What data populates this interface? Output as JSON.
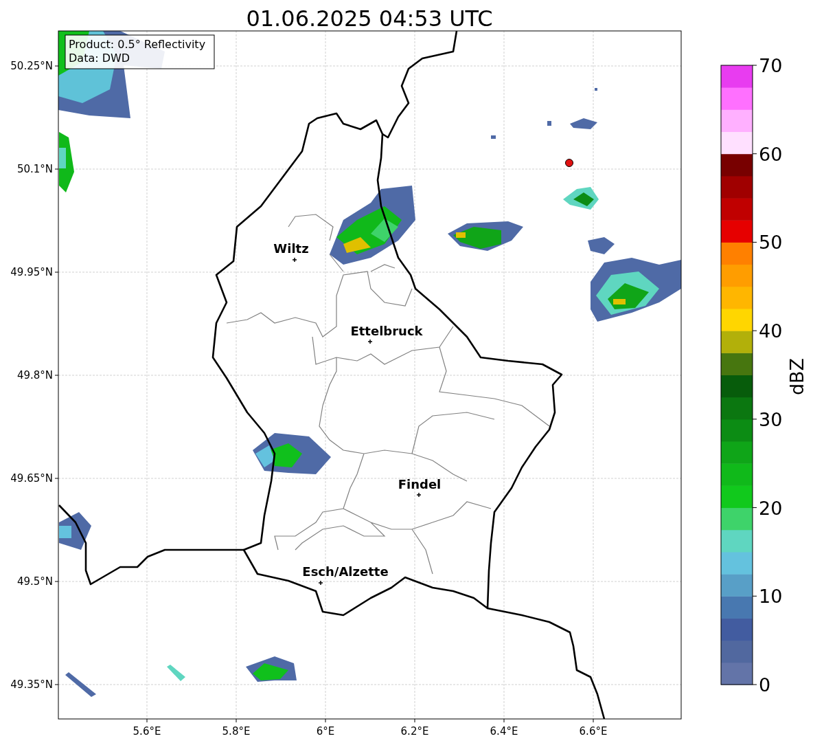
{
  "title": "01.06.2025 04:53 UTC",
  "info_box": [
    "Product: 0.5° Reflectivity",
    "Data: DWD"
  ],
  "map": {
    "x_ticks": [
      "5.6°E",
      "5.8°E",
      "6°E",
      "6.2°E",
      "6.4°E",
      "6.6°E"
    ],
    "y_ticks": [
      "50.25°N",
      "50.1°N",
      "49.95°N",
      "49.8°N",
      "49.65°N",
      "49.5°N",
      "49.35°N"
    ],
    "cities": [
      {
        "name": "Wiltz"
      },
      {
        "name": "Ettelbruck"
      },
      {
        "name": "Findel"
      },
      {
        "name": "Esch/Alzette"
      }
    ]
  },
  "colorbar": {
    "label": "dBZ",
    "ticks": [
      "70",
      "60",
      "50",
      "40",
      "30",
      "20",
      "10",
      "0"
    ],
    "bins": [
      {
        "color": "#6374a8"
      },
      {
        "color": "#51689f"
      },
      {
        "color": "#425ca0"
      },
      {
        "color": "#4878b0"
      },
      {
        "color": "#589fc7"
      },
      {
        "color": "#64c2de"
      },
      {
        "color": "#5fd6c0"
      },
      {
        "color": "#3ed36a"
      },
      {
        "color": "#11c91c"
      },
      {
        "color": "#10b91a"
      },
      {
        "color": "#0fa518"
      },
      {
        "color": "#0c8c14"
      },
      {
        "color": "#0b7710"
      },
      {
        "color": "#075c0b"
      },
      {
        "color": "#47760f"
      },
      {
        "color": "#b2b00a"
      },
      {
        "color": "#ffd600"
      },
      {
        "color": "#ffb600"
      },
      {
        "color": "#ff9d00"
      },
      {
        "color": "#ff8000"
      },
      {
        "color": "#e60000"
      },
      {
        "color": "#c00000"
      },
      {
        "color": "#a00000"
      },
      {
        "color": "#780000"
      },
      {
        "color": "#ffe0ff"
      },
      {
        "color": "#ffb0ff"
      },
      {
        "color": "#ff70ff"
      },
      {
        "color": "#e83cf0"
      }
    ]
  }
}
